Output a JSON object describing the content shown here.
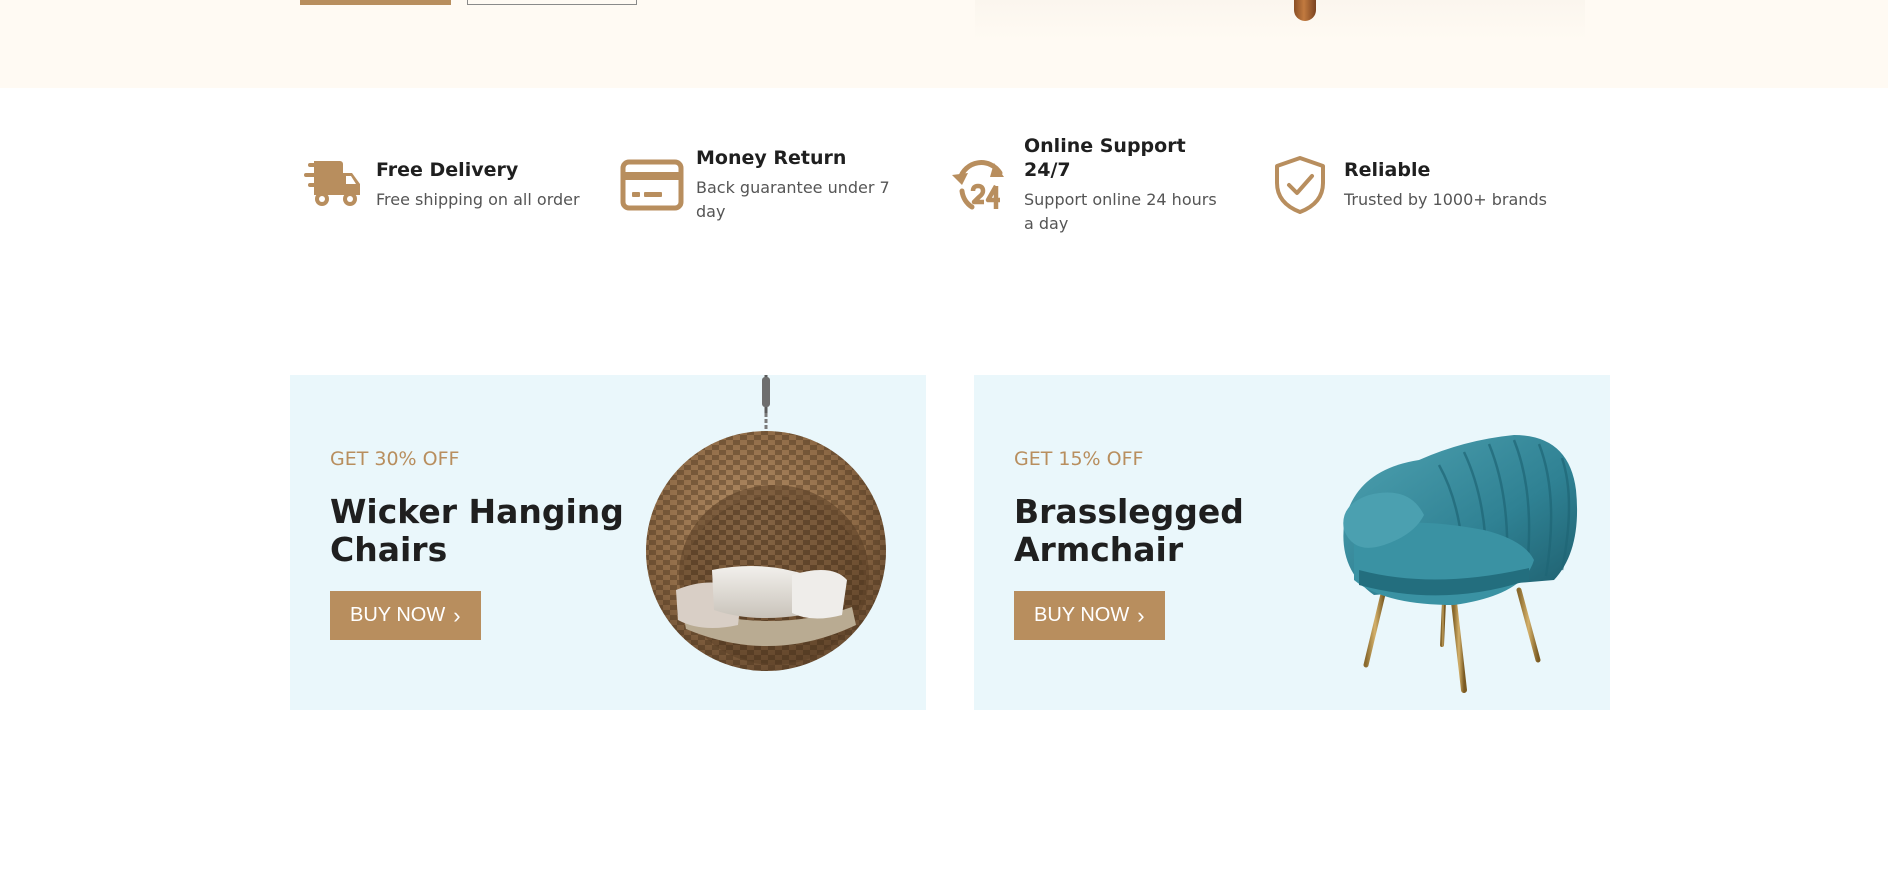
{
  "features": [
    {
      "icon": "delivery-truck-icon",
      "title": "Free Delivery",
      "desc": "Free shipping on all order"
    },
    {
      "icon": "credit-card-icon",
      "title": "Money Return",
      "desc": "Back guarantee under 7 day"
    },
    {
      "icon": "support-24-icon",
      "title": "Online Support 24/7",
      "desc": "Support online 24 hours a day"
    },
    {
      "icon": "shield-check-icon",
      "title": "Reliable",
      "desc": "Trusted by 1000+ brands"
    }
  ],
  "promos": [
    {
      "discount": "GET 30% OFF",
      "title": "Wicker Hanging Chairs",
      "button": "BUY NOW"
    },
    {
      "discount": "GET 15% OFF",
      "title": "Brasslegged Armchair",
      "button": "BUY NOW"
    }
  ],
  "colors": {
    "accent": "#b88e5e",
    "promo_bg": "#eaf7fb",
    "hero_bg": "#fffaf3",
    "text": "#1f1f1f",
    "muted": "#555555"
  }
}
